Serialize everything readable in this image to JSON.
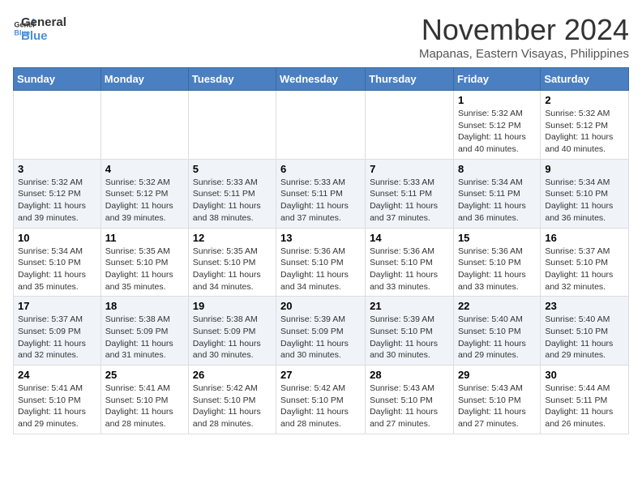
{
  "logo": {
    "line1": "General",
    "line2": "Blue"
  },
  "title": "November 2024",
  "location": "Mapanas, Eastern Visayas, Philippines",
  "weekdays": [
    "Sunday",
    "Monday",
    "Tuesday",
    "Wednesday",
    "Thursday",
    "Friday",
    "Saturday"
  ],
  "weeks": [
    [
      {
        "day": "",
        "detail": ""
      },
      {
        "day": "",
        "detail": ""
      },
      {
        "day": "",
        "detail": ""
      },
      {
        "day": "",
        "detail": ""
      },
      {
        "day": "",
        "detail": ""
      },
      {
        "day": "1",
        "detail": "Sunrise: 5:32 AM\nSunset: 5:12 PM\nDaylight: 11 hours\nand 40 minutes."
      },
      {
        "day": "2",
        "detail": "Sunrise: 5:32 AM\nSunset: 5:12 PM\nDaylight: 11 hours\nand 40 minutes."
      }
    ],
    [
      {
        "day": "3",
        "detail": "Sunrise: 5:32 AM\nSunset: 5:12 PM\nDaylight: 11 hours\nand 39 minutes."
      },
      {
        "day": "4",
        "detail": "Sunrise: 5:32 AM\nSunset: 5:12 PM\nDaylight: 11 hours\nand 39 minutes."
      },
      {
        "day": "5",
        "detail": "Sunrise: 5:33 AM\nSunset: 5:11 PM\nDaylight: 11 hours\nand 38 minutes."
      },
      {
        "day": "6",
        "detail": "Sunrise: 5:33 AM\nSunset: 5:11 PM\nDaylight: 11 hours\nand 37 minutes."
      },
      {
        "day": "7",
        "detail": "Sunrise: 5:33 AM\nSunset: 5:11 PM\nDaylight: 11 hours\nand 37 minutes."
      },
      {
        "day": "8",
        "detail": "Sunrise: 5:34 AM\nSunset: 5:11 PM\nDaylight: 11 hours\nand 36 minutes."
      },
      {
        "day": "9",
        "detail": "Sunrise: 5:34 AM\nSunset: 5:10 PM\nDaylight: 11 hours\nand 36 minutes."
      }
    ],
    [
      {
        "day": "10",
        "detail": "Sunrise: 5:34 AM\nSunset: 5:10 PM\nDaylight: 11 hours\nand 35 minutes."
      },
      {
        "day": "11",
        "detail": "Sunrise: 5:35 AM\nSunset: 5:10 PM\nDaylight: 11 hours\nand 35 minutes."
      },
      {
        "day": "12",
        "detail": "Sunrise: 5:35 AM\nSunset: 5:10 PM\nDaylight: 11 hours\nand 34 minutes."
      },
      {
        "day": "13",
        "detail": "Sunrise: 5:36 AM\nSunset: 5:10 PM\nDaylight: 11 hours\nand 34 minutes."
      },
      {
        "day": "14",
        "detail": "Sunrise: 5:36 AM\nSunset: 5:10 PM\nDaylight: 11 hours\nand 33 minutes."
      },
      {
        "day": "15",
        "detail": "Sunrise: 5:36 AM\nSunset: 5:10 PM\nDaylight: 11 hours\nand 33 minutes."
      },
      {
        "day": "16",
        "detail": "Sunrise: 5:37 AM\nSunset: 5:10 PM\nDaylight: 11 hours\nand 32 minutes."
      }
    ],
    [
      {
        "day": "17",
        "detail": "Sunrise: 5:37 AM\nSunset: 5:09 PM\nDaylight: 11 hours\nand 32 minutes."
      },
      {
        "day": "18",
        "detail": "Sunrise: 5:38 AM\nSunset: 5:09 PM\nDaylight: 11 hours\nand 31 minutes."
      },
      {
        "day": "19",
        "detail": "Sunrise: 5:38 AM\nSunset: 5:09 PM\nDaylight: 11 hours\nand 30 minutes."
      },
      {
        "day": "20",
        "detail": "Sunrise: 5:39 AM\nSunset: 5:09 PM\nDaylight: 11 hours\nand 30 minutes."
      },
      {
        "day": "21",
        "detail": "Sunrise: 5:39 AM\nSunset: 5:10 PM\nDaylight: 11 hours\nand 30 minutes."
      },
      {
        "day": "22",
        "detail": "Sunrise: 5:40 AM\nSunset: 5:10 PM\nDaylight: 11 hours\nand 29 minutes."
      },
      {
        "day": "23",
        "detail": "Sunrise: 5:40 AM\nSunset: 5:10 PM\nDaylight: 11 hours\nand 29 minutes."
      }
    ],
    [
      {
        "day": "24",
        "detail": "Sunrise: 5:41 AM\nSunset: 5:10 PM\nDaylight: 11 hours\nand 29 minutes."
      },
      {
        "day": "25",
        "detail": "Sunrise: 5:41 AM\nSunset: 5:10 PM\nDaylight: 11 hours\nand 28 minutes."
      },
      {
        "day": "26",
        "detail": "Sunrise: 5:42 AM\nSunset: 5:10 PM\nDaylight: 11 hours\nand 28 minutes."
      },
      {
        "day": "27",
        "detail": "Sunrise: 5:42 AM\nSunset: 5:10 PM\nDaylight: 11 hours\nand 28 minutes."
      },
      {
        "day": "28",
        "detail": "Sunrise: 5:43 AM\nSunset: 5:10 PM\nDaylight: 11 hours\nand 27 minutes."
      },
      {
        "day": "29",
        "detail": "Sunrise: 5:43 AM\nSunset: 5:10 PM\nDaylight: 11 hours\nand 27 minutes."
      },
      {
        "day": "30",
        "detail": "Sunrise: 5:44 AM\nSunset: 5:11 PM\nDaylight: 11 hours\nand 26 minutes."
      }
    ]
  ]
}
